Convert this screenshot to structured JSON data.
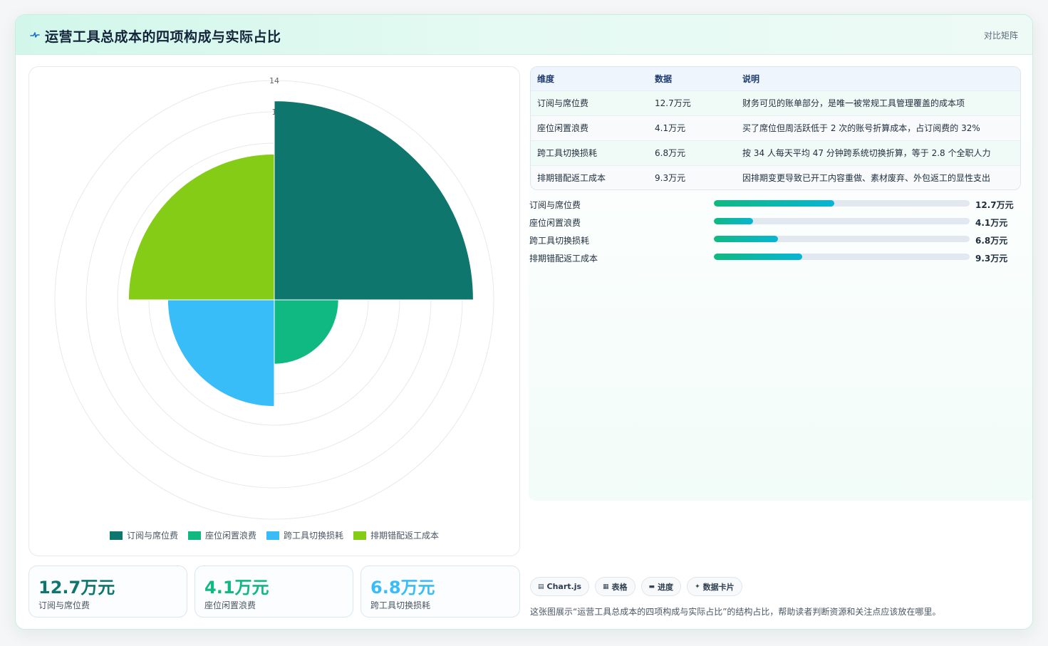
{
  "header": {
    "title": "运营工具总成本的四项构成与实际占比",
    "right_label": "对比矩阵",
    "icon": "pulse-icon"
  },
  "colors": {
    "series": [
      "#0f766e",
      "#10b981",
      "#38bdf8",
      "#84cc16"
    ],
    "stat_values": [
      "#0f766e",
      "#10b981",
      "#38bdf8"
    ]
  },
  "chart_data": {
    "type": "polarArea",
    "title": "",
    "categories": [
      "订阅与席位费",
      "座位闲置浪费",
      "跨工具切换损耗",
      "排期错配返工成本"
    ],
    "values": [
      12.7,
      4.1,
      6.8,
      9.3
    ],
    "r_max": 14,
    "r_ticks": [
      2,
      4,
      6,
      8,
      10,
      12,
      14
    ],
    "r_tick_labels": {
      "12": "1",
      "14": "14"
    },
    "legend_position": "bottom",
    "grid": true
  },
  "table": {
    "headers": [
      "维度",
      "数据",
      "说明"
    ],
    "rows": [
      {
        "dim": "订阅与席位费",
        "val": "12.7万元",
        "note": "财务可见的账单部分，是唯一被常规工具管理覆盖的成本项"
      },
      {
        "dim": "座位闲置浪费",
        "val": "4.1万元",
        "note": "买了席位但周活跃低于 2 次的账号折算成本，占订阅费的 32%"
      },
      {
        "dim": "跨工具切换损耗",
        "val": "6.8万元",
        "note": "按 34 人每天平均 47 分钟跨系统切换折算，等于 2.8 个全职人力"
      },
      {
        "dim": "排期错配返工成本",
        "val": "9.3万元",
        "note": "因排期变更导致已开工内容重做、素材废弃、外包返工的显性支出"
      }
    ]
  },
  "bars": [
    {
      "label": "订阅与席位费",
      "value": 12.7,
      "value_text": "12.7万元"
    },
    {
      "label": "座位闲置浪费",
      "value": 4.1,
      "value_text": "4.1万元"
    },
    {
      "label": "跨工具切换损耗",
      "value": 6.8,
      "value_text": "6.8万元"
    },
    {
      "label": "排期错配返工成本",
      "value": 9.3,
      "value_text": "9.3万元"
    }
  ],
  "bars_max": 27,
  "stats": [
    {
      "value": "12.7万元",
      "label": "订阅与席位费"
    },
    {
      "value": "4.1万元",
      "label": "座位闲置浪费"
    },
    {
      "value": "6.8万元",
      "label": "跨工具切换损耗"
    }
  ],
  "tags": [
    {
      "icon": "▤",
      "label": "Chart.js"
    },
    {
      "icon": "▦",
      "label": "表格"
    },
    {
      "icon": "▬",
      "label": "进度"
    },
    {
      "icon": "✦",
      "label": "数据卡片"
    }
  ],
  "description": "这张图展示“运营工具总成本的四项构成与实际占比”的结构占比，帮助读者判断资源和关注点应该放在哪里。"
}
